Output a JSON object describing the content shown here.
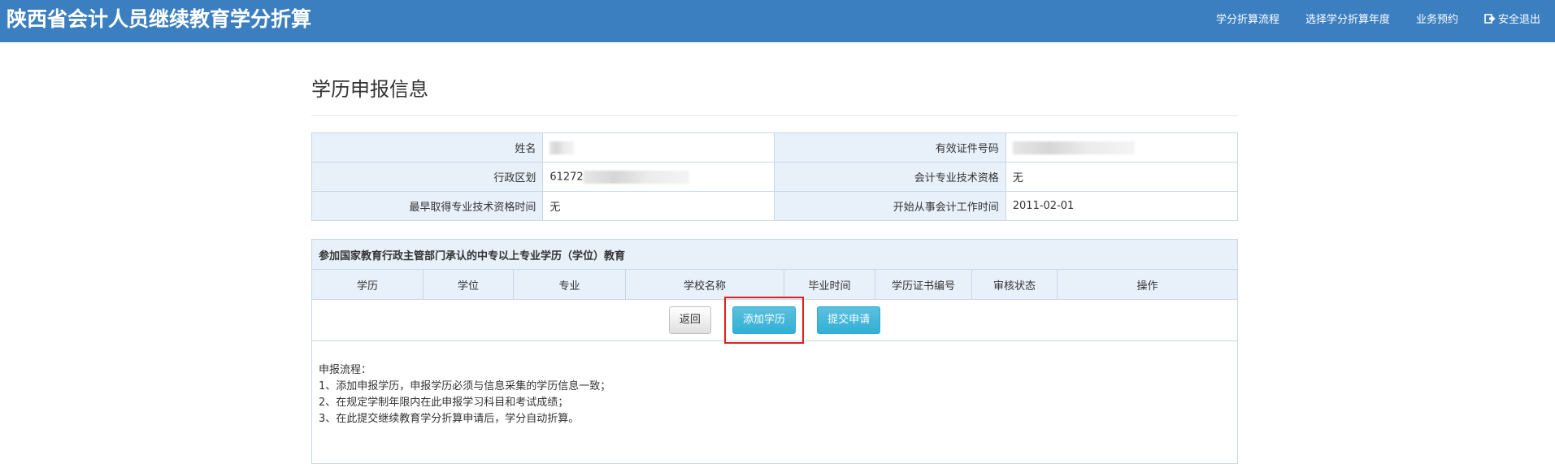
{
  "header": {
    "title": "陕西省会计人员继续教育学分折算",
    "nav": [
      {
        "label": "学分折算流程"
      },
      {
        "label": "选择学分折算年度"
      },
      {
        "label": "业务预约"
      },
      {
        "label": "安全退出",
        "icon": "logout-icon"
      }
    ],
    "colors": {
      "navbar": "#3c7fc0",
      "label_bg": "#e8f0fa",
      "button_info": "#31b0d5",
      "highlight": "#e02020"
    }
  },
  "page": {
    "title": "学历申报信息"
  },
  "info": {
    "name_label": "姓名",
    "name_value": "",
    "id_label": "有效证件号码",
    "id_value": "",
    "region_label": "行政区划",
    "region_value": "61272",
    "qualification_label": "会计专业技术资格",
    "qualification_value": "无",
    "earliest_time_label": "最早取得专业技术资格时间",
    "earliest_time_value": "无",
    "start_work_label": "开始从事会计工作时间",
    "start_work_value": "2011-02-01"
  },
  "education": {
    "caption": "参加国家教育行政主管部门承认的中专以上专业学历（学位）教育",
    "columns": [
      "学历",
      "学位",
      "专业",
      "学校名称",
      "毕业时间",
      "学历证书编号",
      "审核状态",
      "操作"
    ],
    "buttons": {
      "back": "返回",
      "add": "添加学历",
      "submit": "提交申请"
    },
    "notes": [
      "申报流程：",
      "1、添加申报学历，申报学历必须与信息采集的学历信息一致；",
      "2、在规定学制年限内在此申报学习科目和考试成绩；",
      "3、在此提交继续教育学分折算申请后，学分自动折算。"
    ]
  }
}
